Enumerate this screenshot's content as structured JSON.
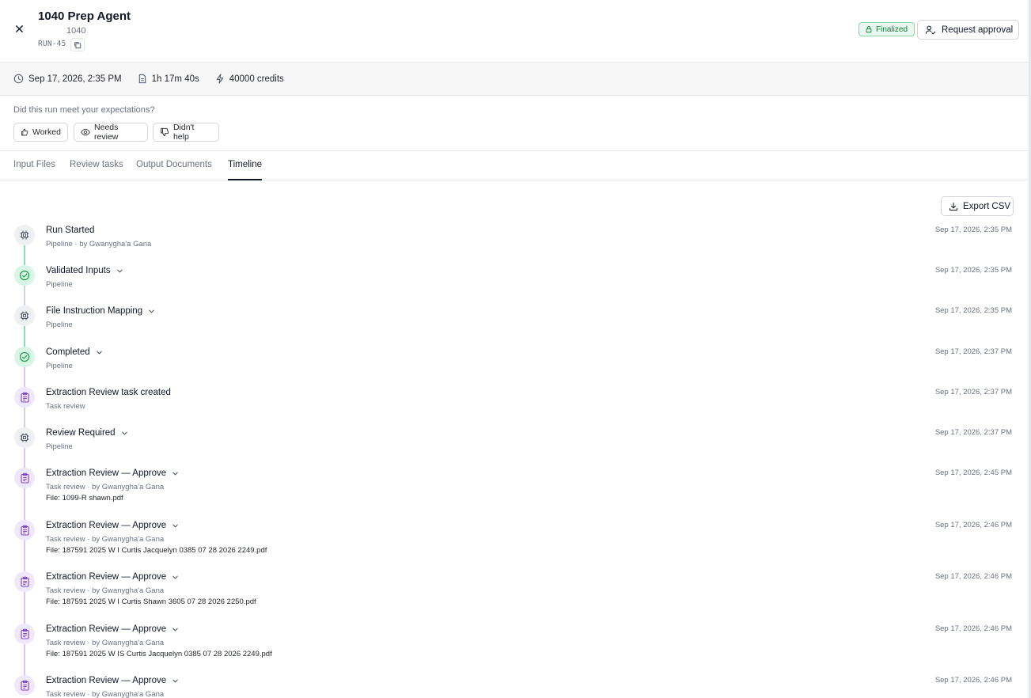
{
  "header": {
    "title": "1040 Prep Agent",
    "subtitle": "1040",
    "run_id": "RUN-45",
    "status_badge": "Finalized",
    "request_approval_label": "Request approval"
  },
  "meta": {
    "datetime": "Sep 17, 2026, 2:35 PM",
    "duration": "1h 17m 40s",
    "credits": "40000 credits"
  },
  "feedback": {
    "question": "Did this run meet your expectations?",
    "buttons": [
      "Worked",
      "Needs review",
      "Didn't help"
    ]
  },
  "tabs": [
    "Input Files",
    "Review tasks",
    "Output Documents",
    "Timeline"
  ],
  "active_tab": "Timeline",
  "export_label": "Export CSV",
  "timeline": [
    {
      "title": "Run Started",
      "sub": "Pipeline · by Gwanygha'a Gana",
      "file": "",
      "time": "Sep 17, 2026, 2:35 PM",
      "icon": "cpu-icon",
      "tone": "gray",
      "expandable": false
    },
    {
      "title": "Validated Inputs",
      "sub": "Pipeline",
      "file": "",
      "time": "Sep 17, 2026, 2:35 PM",
      "icon": "check-circle-icon",
      "tone": "green",
      "expandable": true
    },
    {
      "title": "File Instruction Mapping",
      "sub": "Pipeline",
      "file": "",
      "time": "Sep 17, 2026, 2:35 PM",
      "icon": "cpu-icon",
      "tone": "gray",
      "expandable": true
    },
    {
      "title": "Completed",
      "sub": "Pipeline",
      "file": "",
      "time": "Sep 17, 2026, 2:37 PM",
      "icon": "check-circle-icon",
      "tone": "green",
      "expandable": true
    },
    {
      "title": "Extraction Review task created",
      "sub": "Task review",
      "file": "",
      "time": "Sep 17, 2026, 2:37 PM",
      "icon": "clipboard-icon",
      "tone": "purple",
      "expandable": false
    },
    {
      "title": "Review Required",
      "sub": "Pipeline",
      "file": "",
      "time": "Sep 17, 2026, 2:37 PM",
      "icon": "cpu-icon",
      "tone": "gray",
      "expandable": true
    },
    {
      "title": "Extraction Review — Approve",
      "sub": "Task review · by Gwanygha'a Gana",
      "file": "File: 1099-R shawn.pdf",
      "time": "Sep 17, 2026, 2:45 PM",
      "icon": "clipboard-icon",
      "tone": "purple",
      "expandable": true
    },
    {
      "title": "Extraction Review — Approve",
      "sub": "Task review · by Gwanygha'a Gana",
      "file": "File: 187591 2025 W I Curtis Jacquelyn 0385 07 28 2026 2249.pdf",
      "time": "Sep 17, 2026, 2:46 PM",
      "icon": "clipboard-icon",
      "tone": "purple",
      "expandable": true
    },
    {
      "title": "Extraction Review — Approve",
      "sub": "Task review · by Gwanygha'a Gana",
      "file": "File: 187591 2025 W I Curtis Shawn 3605 07 28 2026 2250.pdf",
      "time": "Sep 17, 2026, 2:46 PM",
      "icon": "clipboard-icon",
      "tone": "purple",
      "expandable": true
    },
    {
      "title": "Extraction Review — Approve",
      "sub": "Task review · by Gwanygha'a Gana",
      "file": "File: 187591 2025 W IS Curtis Jacquelyn 0385 07 28 2026 2249.pdf",
      "time": "Sep 17, 2026, 2:46 PM",
      "icon": "clipboard-icon",
      "tone": "purple",
      "expandable": true
    },
    {
      "title": "Extraction Review — Approve",
      "sub": "Task review · by Gwanygha'a Gana",
      "file": "",
      "time": "Sep 17, 2026, 2:46 PM",
      "icon": "clipboard-icon",
      "tone": "purple",
      "expandable": true
    }
  ],
  "colors": {
    "green_line": "#86e0b0",
    "purple_line": "#d8c8f3",
    "gray_line": "#cfd4db",
    "green_icon": "#16a34a",
    "purple_icon": "#7e3fd6",
    "gray_icon": "#4b5563"
  }
}
